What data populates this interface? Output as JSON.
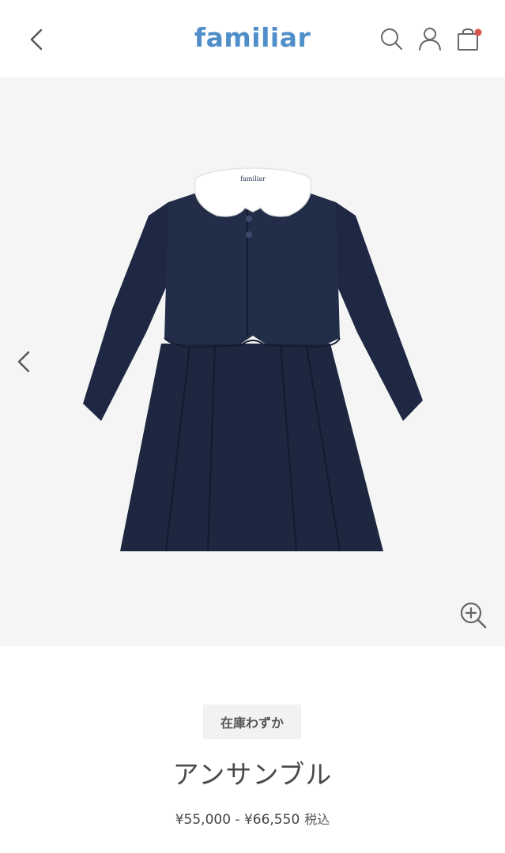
{
  "header": {
    "brand": "familiar",
    "icons": [
      "chevron-left-icon",
      "search-icon",
      "user-icon",
      "shopping-bag-icon"
    ],
    "cart_badge_color": "#d9534f",
    "brand_color": "#4f8ec9"
  },
  "gallery": {
    "background": "#f5f5f5",
    "image_label": "familiar",
    "icons": [
      "chevron-left-icon",
      "zoom-in-icon"
    ]
  },
  "product": {
    "stock_badge": "在庫わずか",
    "name": "アンサンブル",
    "price_range": "¥55,000 - ¥66,550",
    "tax_label": "税込"
  }
}
